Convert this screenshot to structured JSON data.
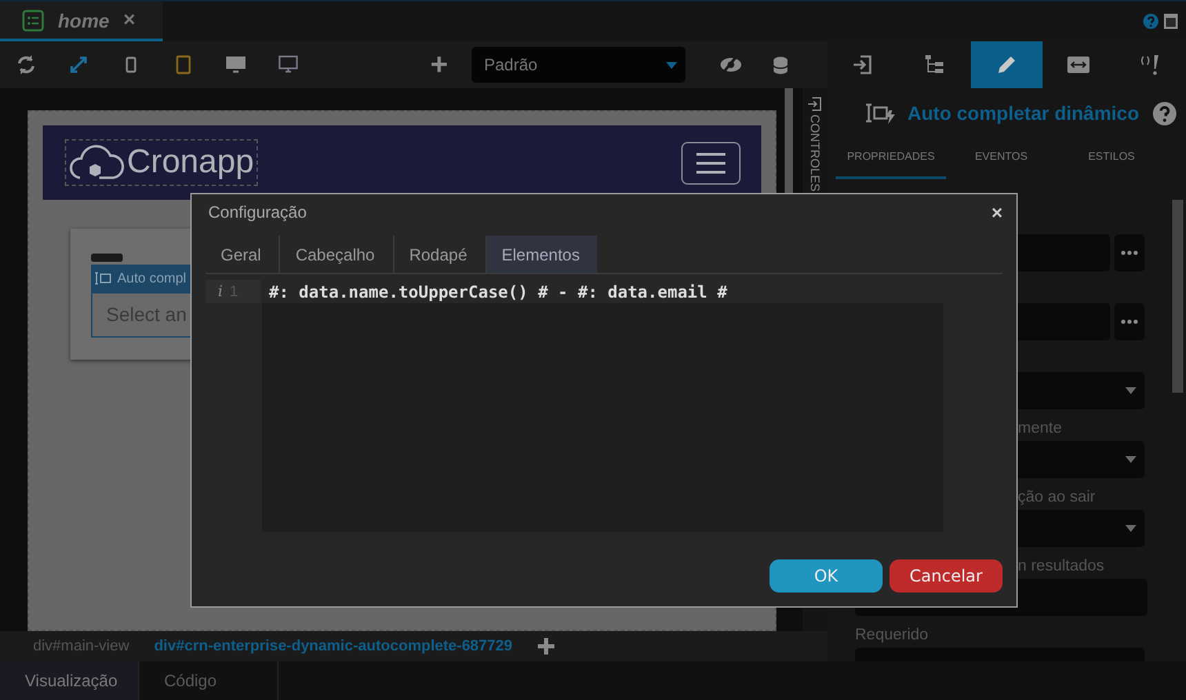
{
  "tab": {
    "title": "home",
    "close": "×"
  },
  "toolbar": {
    "devices": [
      {
        "kind": "fit",
        "selected": true
      },
      {
        "kind": "phone",
        "selected": false
      },
      {
        "kind": "tablet",
        "selected": false
      },
      {
        "kind": "desktop",
        "selected": false
      },
      {
        "kind": "tv",
        "selected": false
      }
    ],
    "add": "+",
    "theme": {
      "value": "Padrão"
    }
  },
  "canvas": {
    "logo": "Cronapp",
    "component_label": "Auto compl",
    "component_placeholder": "Select an"
  },
  "side_strip": {
    "label": "CONTROLES"
  },
  "right_panel": {
    "tools": [
      {
        "kind": "enter",
        "selected": false
      },
      {
        "kind": "tree",
        "selected": false
      },
      {
        "kind": "pencil",
        "selected": true
      },
      {
        "kind": "resize",
        "selected": false
      },
      {
        "kind": "code",
        "selected": false
      }
    ],
    "title": "Auto completar dinâmico",
    "subtabs": [
      {
        "label": "PROPRIEDADES",
        "selected": true
      },
      {
        "label": "EVENTOS",
        "selected": false
      },
      {
        "label": "ESTILOS",
        "selected": false
      }
    ],
    "fields": [
      {
        "kind": "more"
      },
      {
        "kind": "more"
      },
      {
        "kind": "select"
      },
      {
        "kind": "select",
        "label": "mente",
        "covered": true
      },
      {
        "kind": "select",
        "label": "ção ao sair",
        "covered": true
      },
      {
        "kind": "text",
        "label": "n resultados",
        "covered": true
      },
      {
        "kind": "select",
        "label": "Requerido",
        "covered": false
      }
    ]
  },
  "breadcrumb": [
    {
      "label": "div#main-view",
      "selected": false
    },
    {
      "label": "div#crn-enterprise-dynamic-autocomplete-687729",
      "selected": true
    }
  ],
  "bottom_tabs": [
    {
      "label": "Visualização",
      "selected": true
    },
    {
      "label": "Código",
      "selected": false
    }
  ],
  "dialog": {
    "title": "Configuração",
    "close": "×",
    "tabs": [
      {
        "label": "Geral",
        "selected": false
      },
      {
        "label": "Cabeçalho",
        "selected": false
      },
      {
        "label": "Rodapé",
        "selected": false
      },
      {
        "label": "Elementos",
        "selected": true
      }
    ],
    "editor": {
      "marker": "i",
      "lines": [
        {
          "number": "1",
          "text": "#: data.name.toUpperCase() # - #: data.email #"
        }
      ]
    },
    "buttons": [
      {
        "label": "OK",
        "kind": "primary"
      },
      {
        "label": "Cancelar",
        "kind": "danger"
      }
    ]
  }
}
